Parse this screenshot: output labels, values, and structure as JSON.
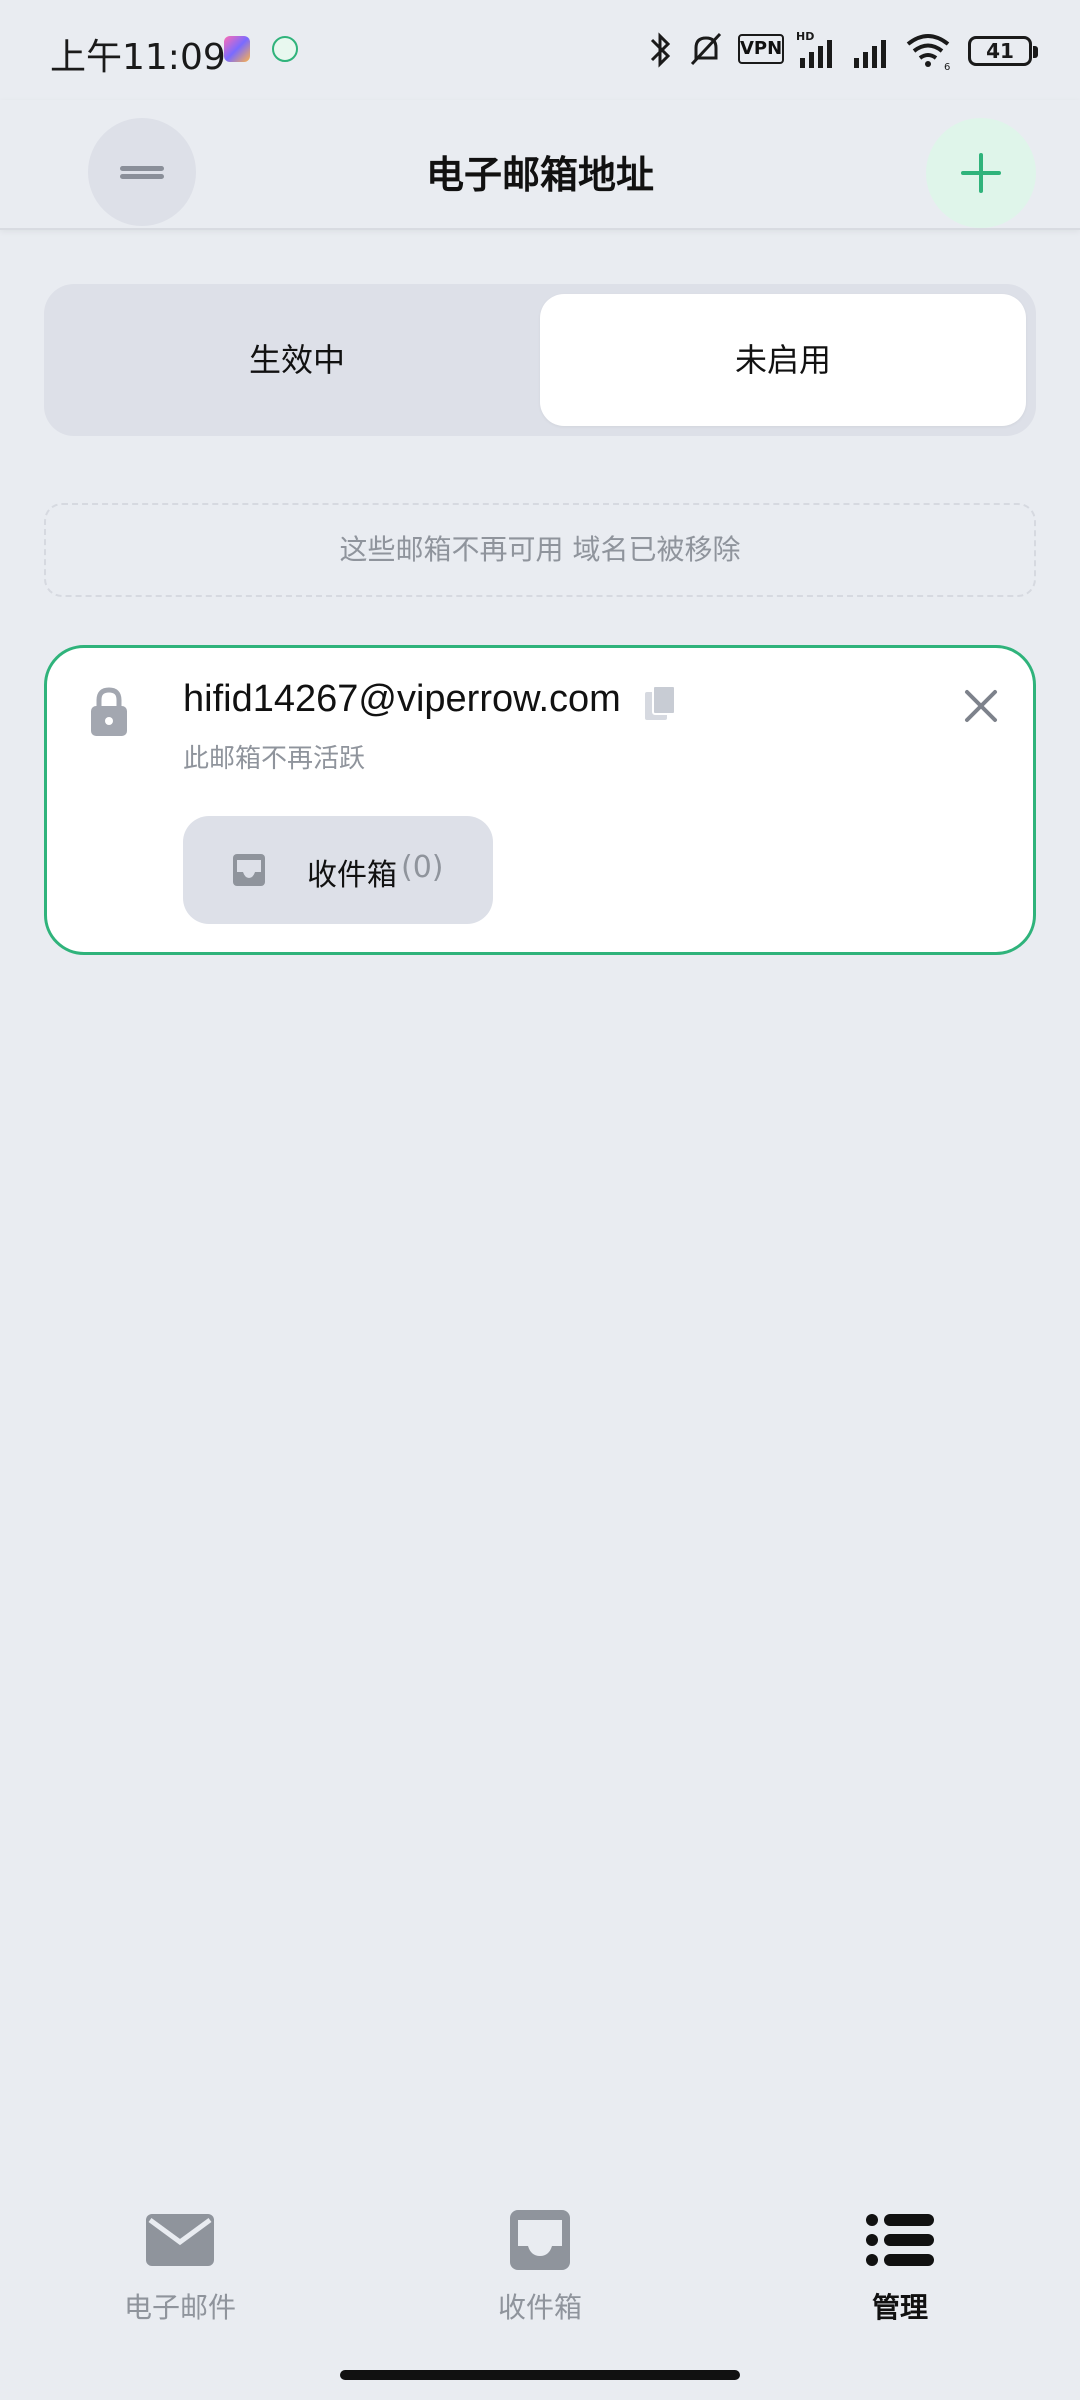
{
  "status_bar": {
    "time": "上午11:09",
    "vpn_label": "VPN",
    "hd_label": "HD",
    "wifi_label": "6",
    "battery": "41"
  },
  "header": {
    "title": "电子邮箱地址",
    "menu_icon": "menu-icon",
    "add_icon": "plus-icon"
  },
  "tabs": [
    {
      "label": "生效中",
      "active": false
    },
    {
      "label": "未启用",
      "active": true
    }
  ],
  "notice": "这些邮箱不再可用 域名已被移除",
  "email_card": {
    "address": "hifid14267@viperrow.com",
    "status": "此邮箱不再活跃",
    "inbox_label": "收件箱",
    "inbox_count": "(0)"
  },
  "bottom_nav": [
    {
      "label": "电子邮件",
      "icon": "mail-icon",
      "active": false
    },
    {
      "label": "收件箱",
      "icon": "inbox-icon",
      "active": false
    },
    {
      "label": "管理",
      "icon": "list-icon",
      "active": true
    }
  ],
  "colors": {
    "accent": "#2fb37b",
    "background": "#e9ecf1",
    "muted_text": "#8f949c"
  }
}
